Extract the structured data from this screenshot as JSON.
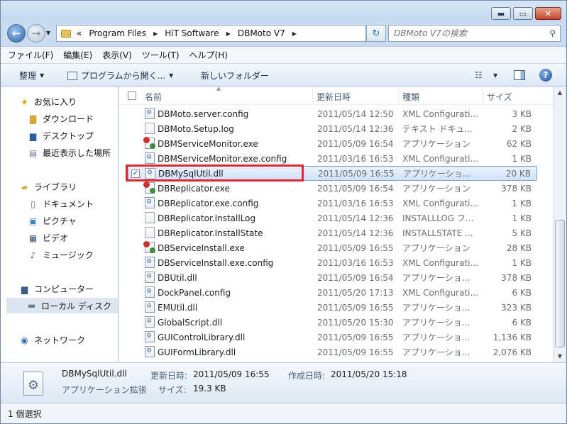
{
  "window": {
    "controls": {
      "minimize": "▬",
      "maximize": "▭",
      "close": "✕"
    }
  },
  "address": {
    "history_glyph": "«",
    "crumbs": [
      "Program Files",
      "HiT Software",
      "DBMoto V7"
    ],
    "search_placeholder": "DBMoto V7の検索"
  },
  "menu": [
    "ファイル(F)",
    "編集(E)",
    "表示(V)",
    "ツール(T)",
    "ヘルプ(H)"
  ],
  "toolbar": {
    "organize": "整理",
    "open_with": "プログラムから開く...",
    "new_folder": "新しいフォルダー"
  },
  "nav": {
    "favorites": "お気に入り",
    "downloads": "ダウンロード",
    "desktop": "デスクトップ",
    "recent": "最近表示した場所",
    "libraries": "ライブラリ",
    "documents": "ドキュメント",
    "pictures": "ピクチャ",
    "videos": "ビデオ",
    "music": "ミュージック",
    "computer": "コンピューター",
    "local_disk": "ローカル ディスク",
    "network": "ネットワーク"
  },
  "columns": {
    "name": "名前",
    "date": "更新日時",
    "type": "種類",
    "size": "サイズ"
  },
  "files": [
    {
      "name": "DBMoto.server.config",
      "date": "2011/05/14 12:50",
      "type": "XML Configurati...",
      "size": "3 KB",
      "icon": "config"
    },
    {
      "name": "DBMoto.Setup.log",
      "date": "2011/05/14 12:36",
      "type": "テキスト ドキュ...",
      "size": "2 KB",
      "icon": "blank"
    },
    {
      "name": "DBMServiceMonitor.exe",
      "date": "2011/05/09 16:54",
      "type": "アプリケーション",
      "size": "62 KB",
      "icon": "exe"
    },
    {
      "name": "DBMServiceMonitor.exe.config",
      "date": "2011/03/16 16:53",
      "type": "XML Configurati...",
      "size": "1 KB",
      "icon": "config"
    },
    {
      "name": "DBMySqlUtil.dll",
      "date": "2011/05/09 16:55",
      "type": "アプリケーショ...",
      "size": "20 KB",
      "icon": "dll",
      "selected": true
    },
    {
      "name": "DBReplicator.exe",
      "date": "2011/05/09 16:54",
      "type": "アプリケーション",
      "size": "378 KB",
      "icon": "exe"
    },
    {
      "name": "DBReplicator.exe.config",
      "date": "2011/03/16 16:53",
      "type": "XML Configurati...",
      "size": "1 KB",
      "icon": "config"
    },
    {
      "name": "DBReplicator.InstallLog",
      "date": "2011/05/14 12:36",
      "type": "INSTALLLOG フ...",
      "size": "1 KB",
      "icon": "blank"
    },
    {
      "name": "DBReplicator.InstallState",
      "date": "2011/05/14 12:36",
      "type": "INSTALLSTATE ...",
      "size": "5 KB",
      "icon": "blank"
    },
    {
      "name": "DBServiceInstall.exe",
      "date": "2011/05/09 16:55",
      "type": "アプリケーション",
      "size": "28 KB",
      "icon": "exe"
    },
    {
      "name": "DBServiceInstall.exe.config",
      "date": "2011/03/16 16:53",
      "type": "XML Configurati...",
      "size": "1 KB",
      "icon": "config"
    },
    {
      "name": "DBUtil.dll",
      "date": "2011/05/09 16:54",
      "type": "アプリケーショ...",
      "size": "378 KB",
      "icon": "dll"
    },
    {
      "name": "DockPanel.config",
      "date": "2011/05/20 17:13",
      "type": "XML Configurati...",
      "size": "6 KB",
      "icon": "config"
    },
    {
      "name": "EMUtil.dll",
      "date": "2011/05/09 16:55",
      "type": "アプリケーショ...",
      "size": "323 KB",
      "icon": "dll"
    },
    {
      "name": "GlobalScript.dll",
      "date": "2011/05/20 15:30",
      "type": "アプリケーショ...",
      "size": "6 KB",
      "icon": "dll"
    },
    {
      "name": "GUIControlLibrary.dll",
      "date": "2011/05/09 16:55",
      "type": "アプリケーショ...",
      "size": "1,136 KB",
      "icon": "dll"
    },
    {
      "name": "GUIFormLibrary.dll",
      "date": "2011/05/09 16:55",
      "type": "アプリケーショ...",
      "size": "2,076 KB",
      "icon": "dll"
    }
  ],
  "details": {
    "name": "DBMySqlUtil.dll",
    "modified_label": "更新日時:",
    "modified_value": "2011/05/09 16:55",
    "created_label": "作成日時:",
    "created_value": "2011/05/20 15:18",
    "type": "アプリケーション拡張",
    "size_label": "サイズ:",
    "size_value": "19.3 KB"
  },
  "status": "1 個選択"
}
